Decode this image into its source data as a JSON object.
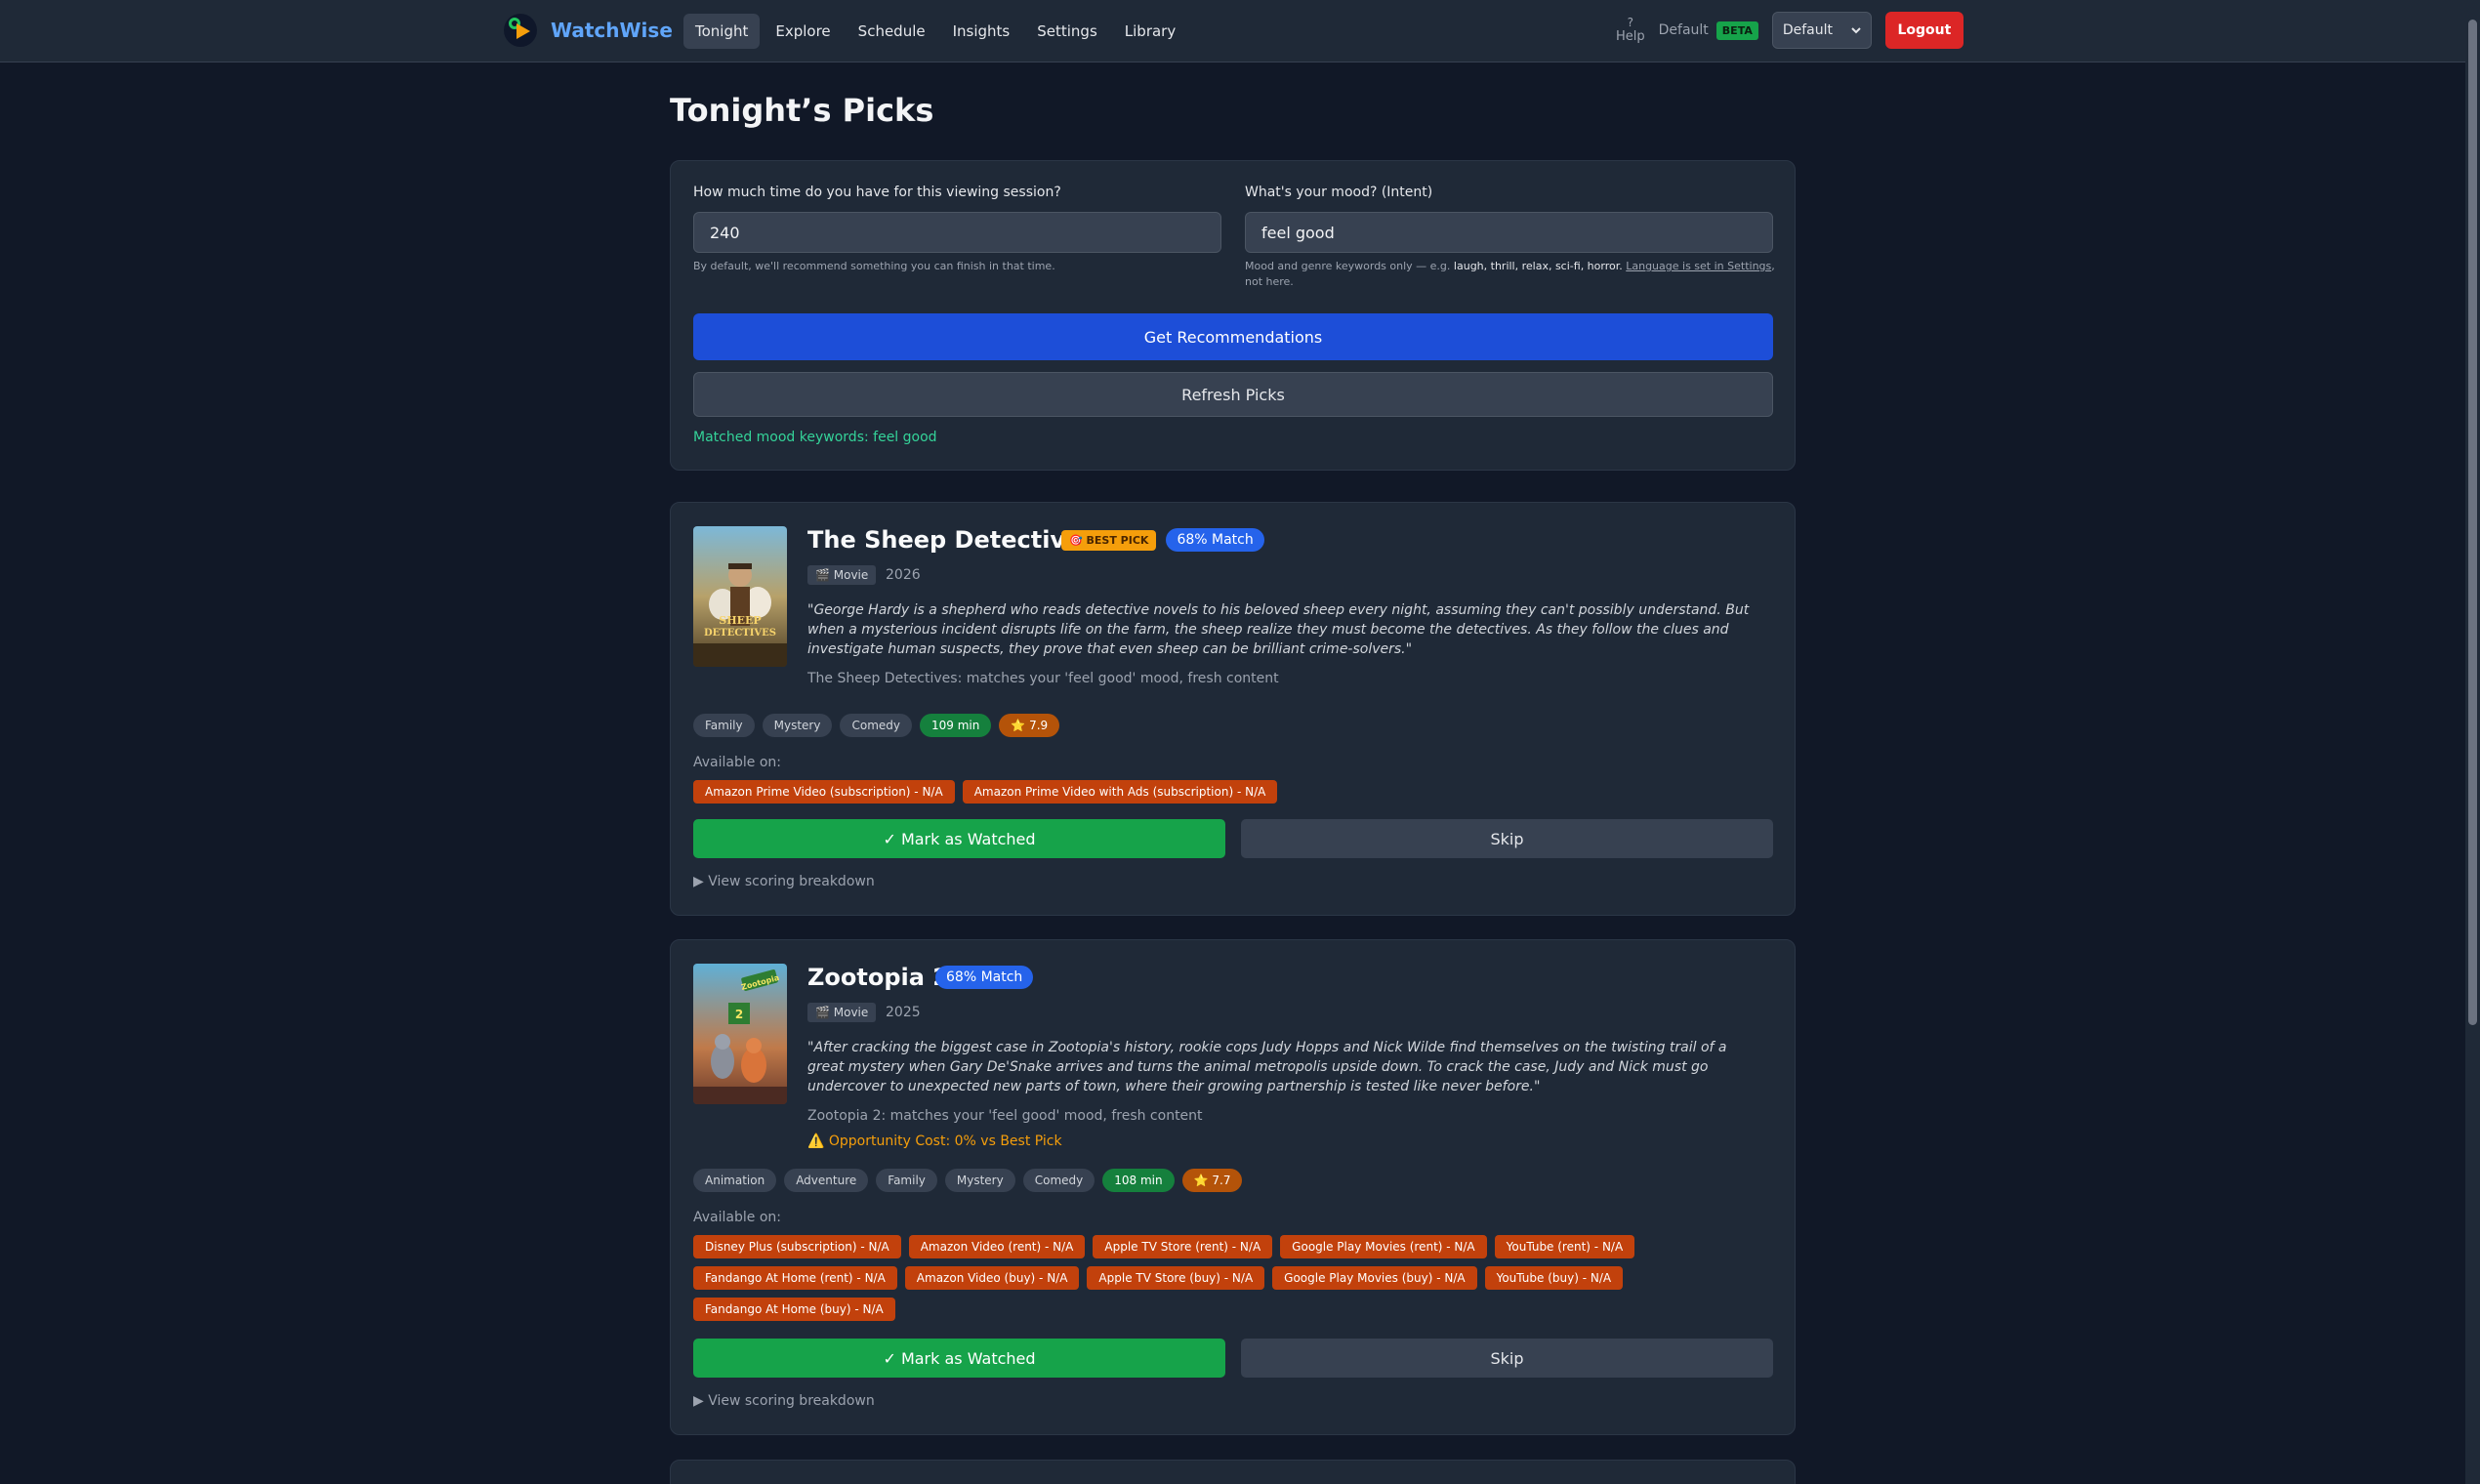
{
  "nav": {
    "brand": "WatchWise",
    "links": [
      "Tonight",
      "Explore",
      "Schedule",
      "Insights",
      "Settings",
      "Library"
    ],
    "help_icon": "?",
    "help_label": "Help",
    "profile_name": "Default",
    "beta_label": "BETA",
    "profile_select": "Default",
    "logout_label": "Logout"
  },
  "page": {
    "title": "Tonight’s Picks"
  },
  "form": {
    "time_label": "How much time do you have for this viewing session?",
    "time_value": "240",
    "time_hint": "By default, we'll recommend something you can finish in that time.",
    "mood_label": "What's your mood? (Intent)",
    "mood_value": "feel good",
    "mood_hint_prefix": "Mood and genre keywords only — e.g.",
    "mood_hint_keywords": "laugh, thrill, relax, sci-fi, horror.",
    "mood_hint_link": "Language is set in Settings",
    "mood_hint_suffix": ", not here.",
    "get_recs_label": "Get Recommendations",
    "refresh_label": "Refresh Picks",
    "matched_text": "Matched mood keywords: feel good"
  },
  "picks": [
    {
      "title": "The Sheep Detectives",
      "best_pick_label": "🎯 BEST PICK",
      "match_label": "68% Match",
      "type": "🎬 Movie",
      "year": "2026",
      "description": "\"George Hardy is a shepherd who reads detective novels to his beloved sheep every night, assuming they can't possibly understand. But when a mysterious incident disrupts life on the farm, the sheep realize they must become the detectives. As they follow the clues and investigate human suspects, they prove that even sheep can be brilliant crime-solvers.\"",
      "reason": "The Sheep Detectives: matches your 'feel good' mood, fresh content",
      "genres": [
        "Family",
        "Mystery",
        "Comedy"
      ],
      "runtime": "109 min",
      "rating": "⭐ 7.9",
      "available_label": "Available on:",
      "providers": [
        "Amazon Prime Video (subscription) - N/A",
        "Amazon Prime Video with Ads (subscription) - N/A"
      ],
      "watched_label": "✓ Mark as Watched",
      "skip_label": "Skip",
      "breakdown_label": "▶ View scoring breakdown"
    },
    {
      "title": "Zootopia 2",
      "match_label": "68% Match",
      "type": "🎬 Movie",
      "year": "2025",
      "description": "\"After cracking the biggest case in Zootopia's history, rookie cops Judy Hopps and Nick Wilde find themselves on the twisting trail of a great mystery when Gary De'Snake arrives and turns the animal metropolis upside down. To crack the case, Judy and Nick must go undercover to unexpected new parts of town, where their growing partnership is tested like never before.\"",
      "reason": "Zootopia 2: matches your 'feel good' mood, fresh content",
      "opportunity": "⚠️ Opportunity Cost: 0% vs Best Pick",
      "genres": [
        "Animation",
        "Adventure",
        "Family",
        "Mystery",
        "Comedy"
      ],
      "runtime": "108 min",
      "rating": "⭐ 7.7",
      "available_label": "Available on:",
      "providers": [
        "Disney Plus (subscription) - N/A",
        "Amazon Video (rent) - N/A",
        "Apple TV Store (rent) - N/A",
        "Google Play Movies (rent) - N/A",
        "YouTube (rent) - N/A",
        "Fandango At Home (rent) - N/A",
        "Amazon Video (buy) - N/A",
        "Apple TV Store (buy) - N/A",
        "Google Play Movies (buy) - N/A",
        "YouTube (buy) - N/A",
        "Fandango At Home (buy) - N/A"
      ],
      "watched_label": "✓ Mark as Watched",
      "skip_label": "Skip",
      "breakdown_label": "▶ View scoring breakdown"
    }
  ],
  "colors": {
    "background": "#111827",
    "card": "#1f2937",
    "primary": "#1d4ed8",
    "success": "#16a34a",
    "danger": "#dc2626",
    "provider": "#c2410c",
    "accent": "#f59e0b"
  }
}
